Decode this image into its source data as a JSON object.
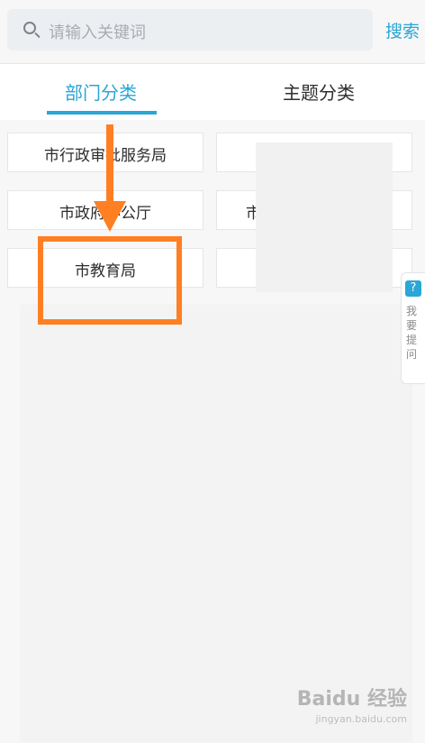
{
  "search": {
    "placeholder": "请输入关键词",
    "button_label": "搜索",
    "icon": "search-icon"
  },
  "tabs": {
    "items": [
      {
        "label": "部门分类",
        "active": true
      },
      {
        "label": "主题分类",
        "active": false
      }
    ],
    "accent_color": "#29a6d6"
  },
  "departments": [
    "市行政审批服务局",
    "市政府办公厅",
    "市教育局"
  ],
  "partial_right_label": "市",
  "help_tab": {
    "icon": "question-icon",
    "text": "我要提问"
  },
  "annotation": {
    "color": "#ff7f22"
  },
  "watermark": {
    "brand": "Baidu 经验",
    "url": "jingyan.baidu.com"
  }
}
